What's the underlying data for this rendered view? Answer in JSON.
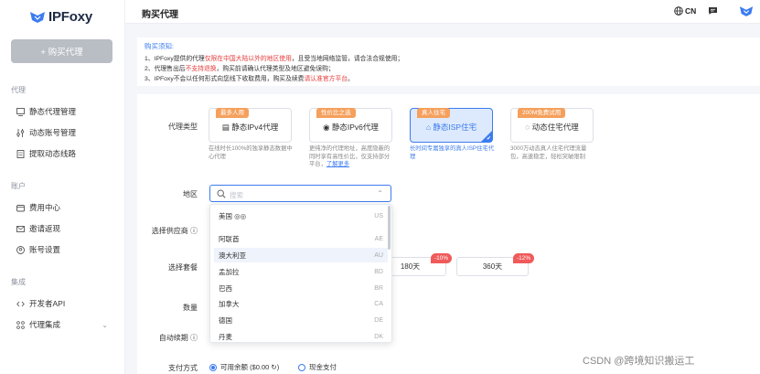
{
  "app": {
    "logo_text": "IPFoxy",
    "buy_button": "+ 购买代理"
  },
  "sidebar": {
    "groups": [
      {
        "label": "代理",
        "items": [
          {
            "label": "静态代理管理",
            "icon": "monitor-icon"
          },
          {
            "label": "动态账号管理",
            "icon": "sliders-icon"
          },
          {
            "label": "提取动态线路",
            "icon": "document-icon"
          }
        ]
      },
      {
        "label": "账户",
        "items": [
          {
            "label": "费用中心",
            "icon": "wallet-icon"
          },
          {
            "label": "邀请返现",
            "icon": "mail-icon"
          },
          {
            "label": "账号设置",
            "icon": "user-icon"
          }
        ]
      },
      {
        "label": "集成",
        "items": [
          {
            "label": "开发者API",
            "icon": "code-icon"
          },
          {
            "label": "代理集成",
            "icon": "integration-icon"
          }
        ]
      }
    ]
  },
  "header": {
    "title": "购买代理",
    "lang": "CN"
  },
  "notice": {
    "title": "购买须知:",
    "line1_a": "1、IPFoxy提供的代理",
    "line1_red": "仅限在中国大陆以外的地区使用",
    "line1_b": "，且受当地网络监管，请合法合规使用；",
    "line2_a": "2、代理售出后",
    "line2_red": "不支持退换",
    "line2_b": "，购买前请确认代理类型及地区避免误购；",
    "line3_a": "3、IPFoxy不会以任何形式向您线下收取费用，购买及续费",
    "line3_red": "请认准官方平台",
    "line3_b": "。"
  },
  "form": {
    "proxy_type_label": "代理类型",
    "region_label": "地区",
    "provider_label": "选择供应商 ⓘ",
    "package_label": "选择套餐",
    "quantity_label": "数量",
    "auto_renew_label": "自动续期 ⓘ",
    "payment_label": "支付方式",
    "region_placeholder": "搜索"
  },
  "proxy_types": [
    {
      "tag": "最多人用",
      "name": "▤ 静态IPv4代理",
      "desc": "在线时长100%的独享静态数据中心代理",
      "selected": false
    },
    {
      "tag": "性价比之选",
      "name": "◉ 静态IPv6代理",
      "desc": "更纯净的代理地址，高度隐蔽的同时享有高性价比，仅支持部分平台，",
      "link": "了解更多",
      "selected": false
    },
    {
      "tag": "真人住宅",
      "name": "⌂ 静态ISP住宅",
      "desc": "长时间专属独享的真人ISP住宅代理",
      "selected": true
    },
    {
      "tag": "200M免费试用",
      "name": "◌ 动态住宅代理",
      "desc": "3000万动态真人住宅代理流量包，高速稳定，轻松突破限制",
      "selected": false
    }
  ],
  "regions": [
    {
      "name": "美国 ◎◎",
      "code": "US"
    },
    {
      "name": "阿联酋",
      "code": "AE"
    },
    {
      "name": "澳大利亚",
      "code": "AU"
    },
    {
      "name": "孟加拉",
      "code": "BD"
    },
    {
      "name": "巴西",
      "code": "BR"
    },
    {
      "name": "加拿大",
      "code": "CA"
    },
    {
      "name": "德国",
      "code": "DE"
    },
    {
      "name": "丹麦",
      "code": "DK"
    }
  ],
  "packages": [
    {
      "label": "180天",
      "discount": "-10%"
    },
    {
      "label": "360天",
      "discount": "-12%"
    }
  ],
  "payment": {
    "balance": "可用余额 ($0.00 ↻)",
    "cash": "现金支付"
  },
  "watermark": "CSDN @跨境知识搬运工",
  "colors": {
    "accent": "#3c7cf0",
    "warn": "#e63b3b",
    "tag": "#f5a05c",
    "discount": "#f05a5a"
  }
}
